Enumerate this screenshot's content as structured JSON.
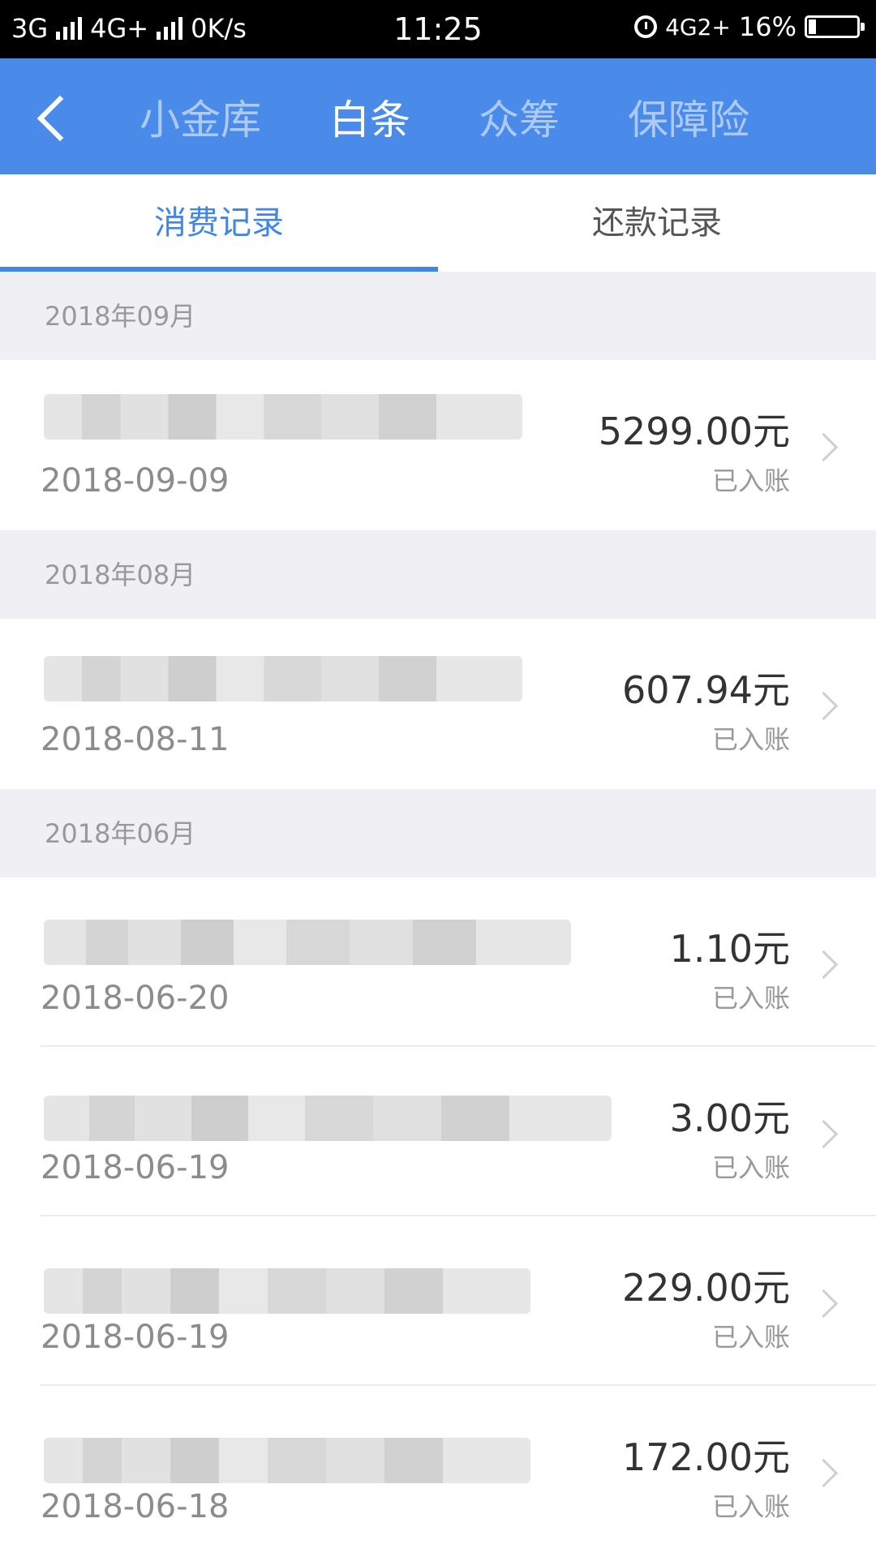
{
  "status_bar": {
    "network_1": "3G",
    "network_2": "4G+",
    "speed": "0K/s",
    "time": "11:25",
    "network_3": "4G2+",
    "battery": "16%"
  },
  "nav": {
    "tabs": [
      {
        "label": "小金库"
      },
      {
        "label": "白条"
      },
      {
        "label": "众筹"
      },
      {
        "label": "保障险"
      }
    ],
    "active_tab": "白条"
  },
  "subtabs": {
    "items": [
      {
        "label": "消费记录"
      },
      {
        "label": "还款记录"
      }
    ],
    "active": "消费记录"
  },
  "sections": [
    {
      "month": "2018年09月",
      "items": [
        {
          "date": "2018-09-09",
          "amount": "5299.00元",
          "status": "已入账"
        }
      ]
    },
    {
      "month": "2018年08月",
      "items": [
        {
          "date": "2018-08-11",
          "amount": "607.94元",
          "status": "已入账"
        }
      ]
    },
    {
      "month": "2018年06月",
      "items": [
        {
          "date": "2018-06-20",
          "amount": "1.10元",
          "status": "已入账"
        },
        {
          "date": "2018-06-19",
          "amount": "3.00元",
          "status": "已入账"
        },
        {
          "date": "2018-06-19",
          "amount": "229.00元",
          "status": "已入账"
        },
        {
          "date": "2018-06-18",
          "amount": "172.00元",
          "status": "已入账"
        }
      ]
    }
  ],
  "colors": {
    "nav_bg": "#4a8ae8",
    "accent": "#3f86e6",
    "section_bg": "#efeff4"
  },
  "battery_level": 0.16
}
